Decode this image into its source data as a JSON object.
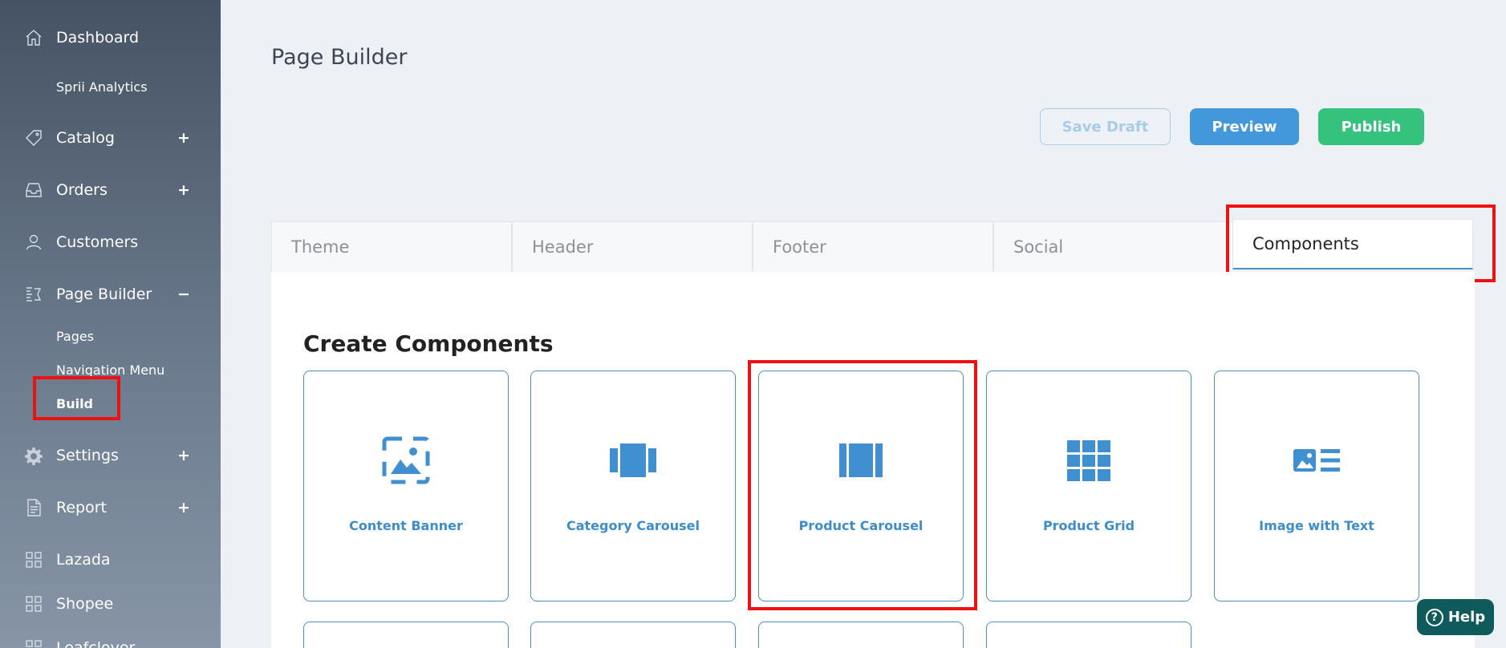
{
  "sidebar": {
    "items": [
      {
        "label": "Dashboard",
        "icon": "home-icon",
        "toggle": ""
      },
      {
        "label": "Catalog",
        "icon": "tag-icon",
        "toggle": "+"
      },
      {
        "label": "Orders",
        "icon": "inbox-icon",
        "toggle": "+"
      },
      {
        "label": "Customers",
        "icon": "user-icon",
        "toggle": ""
      },
      {
        "label": "Page Builder",
        "icon": "page-builder-icon",
        "toggle": "−"
      },
      {
        "label": "Settings",
        "icon": "gear-icon",
        "toggle": "+"
      },
      {
        "label": "Report",
        "icon": "document-icon",
        "toggle": "+"
      },
      {
        "label": "Lazada",
        "icon": "grid-icon",
        "toggle": ""
      },
      {
        "label": "Shopee",
        "icon": "grid-icon",
        "toggle": ""
      },
      {
        "label": "Leafclover",
        "icon": "grid-icon",
        "toggle": ""
      }
    ],
    "sub": {
      "dashboard": [
        "Sprii Analytics"
      ],
      "page_builder": [
        "Pages",
        "Navigation Menu",
        "Build"
      ]
    }
  },
  "main": {
    "title": "Page Builder",
    "buttons": {
      "save_draft": "Save Draft",
      "preview": "Preview",
      "publish": "Publish"
    },
    "tabs": [
      "Theme",
      "Header",
      "Footer",
      "Social",
      "Components"
    ],
    "active_tab": "Components",
    "section_title": "Create Components",
    "components": [
      {
        "label": "Content Banner",
        "icon": "image-icon"
      },
      {
        "label": "Category Carousel",
        "icon": "carousel-icon"
      },
      {
        "label": "Product Carousel",
        "icon": "product-carousel-icon"
      },
      {
        "label": "Product Grid",
        "icon": "grid-icon"
      },
      {
        "label": "Image with Text",
        "icon": "image-text-icon"
      }
    ]
  },
  "help": {
    "label": "Help"
  },
  "colors": {
    "accent": "#3d8ccc",
    "preview": "#4397db",
    "publish": "#34c27d",
    "highlight": "#ee1111",
    "help_bg": "#0f5a5a"
  }
}
